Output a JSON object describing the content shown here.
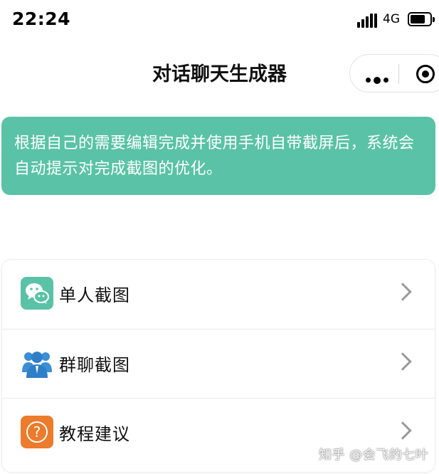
{
  "status_bar": {
    "time": "22:24",
    "network": "4G"
  },
  "nav": {
    "title": "对话聊天生成器"
  },
  "notice": {
    "text": "根据自己的需要编辑完成并使用手机自带截屏后，系统会自动提示对完成截图的优化。"
  },
  "menu": {
    "items": [
      {
        "label": "单人截图",
        "icon": "wechat-chat-icon"
      },
      {
        "label": "群聊截图",
        "icon": "group-users-icon"
      },
      {
        "label": "教程建议",
        "icon": "question-icon"
      }
    ]
  },
  "colors": {
    "accent_green": "#5ac2a6",
    "group_blue": "#3a8fd6",
    "help_orange": "#ec7b2c"
  },
  "watermark": "知乎 @会飞的七叶"
}
